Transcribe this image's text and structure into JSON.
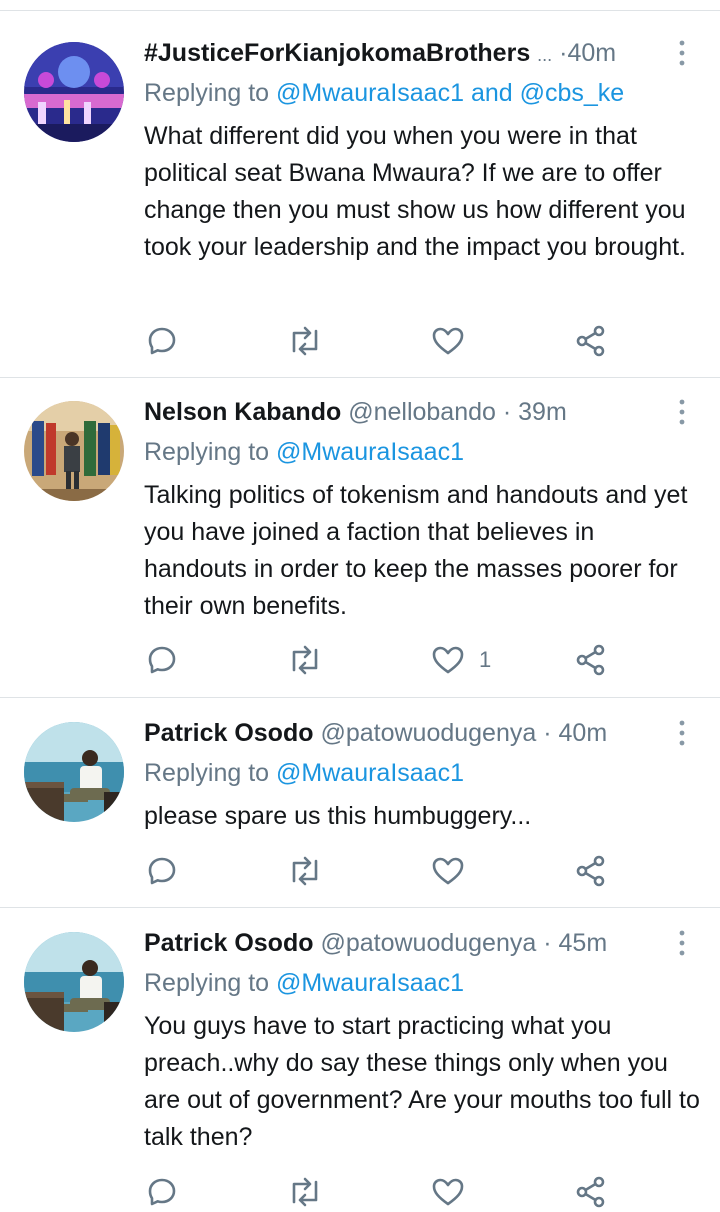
{
  "tweets": [
    {
      "name": "#JusticeForKianjokomaBrothers",
      "handle": "",
      "ellipsis": "...",
      "dot": "·",
      "time": "40m",
      "replying_prefix": "Replying to",
      "mentions": [
        "@MwauraIsaac1",
        "@cbs_ke"
      ],
      "mention_joiner": "and",
      "body": "What different did you when you were in that political seat Bwana Mwaura? If we are to offer change then you must show us how different you took your leadership and the impact you brought.",
      "like_count": ""
    },
    {
      "name": "Nelson Kabando",
      "handle": "@nellobando",
      "dot": "·",
      "time": "39m",
      "replying_prefix": "Replying to",
      "mentions": [
        "@MwauraIsaac1"
      ],
      "body": "Talking politics of tokenism and handouts and yet you have joined a faction that believes in handouts in order to keep the masses poorer for their own benefits.",
      "like_count": "1"
    },
    {
      "name": "Patrick Osodo",
      "handle": "@patowuodugenya",
      "dot": "·",
      "time": "40m",
      "replying_prefix": "Replying to",
      "mentions": [
        "@MwauraIsaac1"
      ],
      "body": "please spare us this humbuggery...",
      "like_count": ""
    },
    {
      "name": "Patrick Osodo",
      "handle": "@patowuodugenya",
      "dot": "·",
      "time": "45m",
      "replying_prefix": "Replying to",
      "mentions": [
        "@MwauraIsaac1"
      ],
      "body": "You guys have to start practicing what you preach..why do say these things only when you are out of government? Are your mouths too full to talk then?",
      "like_count": ""
    }
  ],
  "icons": {
    "reply": "reply-icon",
    "retweet": "retweet-icon",
    "like": "heart-icon",
    "share": "share-icon",
    "more": "more-vertical-icon"
  },
  "colors": {
    "name": "#14171a",
    "secondary": "#657786",
    "mention": "#1b95e0",
    "divider": "#dfe3e6"
  }
}
